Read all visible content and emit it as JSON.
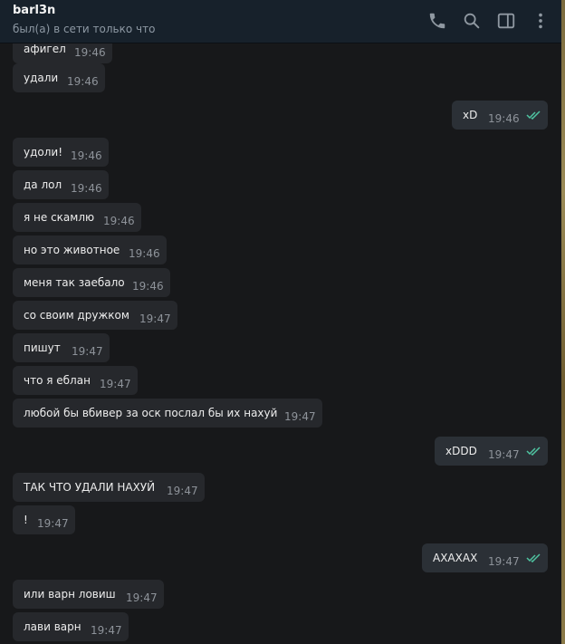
{
  "header": {
    "contact_name": "barl3n",
    "status": "был(а) в сети только что",
    "icons": [
      "phone-icon",
      "search-icon",
      "sidebar-toggle-icon",
      "more-vertical-icon"
    ]
  },
  "colors": {
    "check_read": "#4fc3a1",
    "accent": "#5ea4e8"
  },
  "messages": [
    {
      "direction": "in",
      "text": "афигел",
      "time": "19:46"
    },
    {
      "direction": "in",
      "text": "удали",
      "time": "19:46"
    },
    {
      "direction": "out",
      "text": "xD",
      "time": "19:46",
      "read": true
    },
    {
      "direction": "in",
      "text": "удоли!",
      "time": "19:46"
    },
    {
      "direction": "in",
      "text": "да лол",
      "time": "19:46"
    },
    {
      "direction": "in",
      "text": "я не скамлю",
      "time": "19:46"
    },
    {
      "direction": "in",
      "text": "но это животное",
      "time": "19:46"
    },
    {
      "direction": "in",
      "text": "меня так заебало",
      "time": "19:46"
    },
    {
      "direction": "in",
      "text": "со своим дружком",
      "time": "19:47"
    },
    {
      "direction": "in",
      "text": "пишут",
      "time": "19:47"
    },
    {
      "direction": "in",
      "text": "что я еблан",
      "time": "19:47"
    },
    {
      "direction": "in",
      "text": "любой бы вбивер за оск послал бы их нахуй",
      "time": "19:47"
    },
    {
      "direction": "out",
      "text": "xDDD",
      "time": "19:47",
      "read": true
    },
    {
      "direction": "in",
      "text": "ТАК ЧТО УДАЛИ НАХУЙ",
      "time": "19:47"
    },
    {
      "direction": "in",
      "text": "!",
      "time": "19:47"
    },
    {
      "direction": "out",
      "text": "АХАХАХ",
      "time": "19:47",
      "read": true
    },
    {
      "direction": "in",
      "text": "или варн ловиш",
      "time": "19:47"
    },
    {
      "direction": "in",
      "text": "лави варн",
      "time": "19:47"
    }
  ]
}
